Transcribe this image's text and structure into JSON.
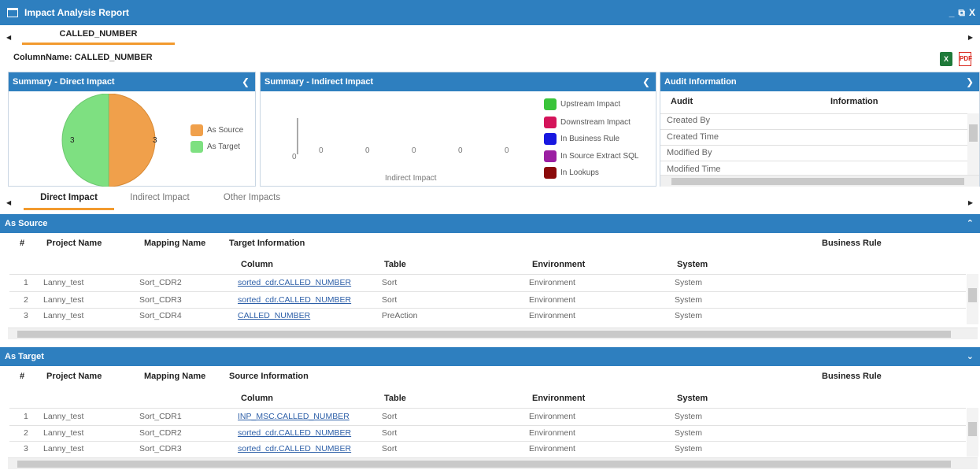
{
  "window": {
    "title": "Impact Analysis Report",
    "minimize": "_",
    "restore": "⧉",
    "close": "X"
  },
  "top_tab": {
    "label": "CALLED_NUMBER"
  },
  "column_name_label": "ColumnName: CALLED_NUMBER",
  "export": {
    "excel_icon": "excel-export-icon",
    "pdf_icon": "pdf-export-icon"
  },
  "direct_panel": {
    "title": "Summary - Direct Impact",
    "legend": [
      {
        "label": "As Source",
        "color": "#f0a04b"
      },
      {
        "label": "As Target",
        "color": "#7ee081"
      }
    ],
    "pie_labels": {
      "target": "3",
      "source": "3"
    }
  },
  "indirect_panel": {
    "title": "Summary - Indirect Impact",
    "axis_zero": "0",
    "bar_zero_labels": [
      "0",
      "0",
      "0",
      "0",
      "0"
    ],
    "x_label": "Indirect Impact",
    "legend": [
      {
        "label": "Upstream Impact",
        "color": "#3ac43a"
      },
      {
        "label": "Downstream Impact",
        "color": "#d4145a"
      },
      {
        "label": "In Business Rule",
        "color": "#1818e0"
      },
      {
        "label": "In Source Extract SQL",
        "color": "#9b1fa2"
      },
      {
        "label": "In Lookups",
        "color": "#8b0a0a"
      }
    ]
  },
  "audit_panel": {
    "title": "Audit Information",
    "headers": {
      "audit": "Audit",
      "information": "Information"
    },
    "rows": [
      "Created By",
      "Created Time",
      "Modified By",
      "Modified Time"
    ]
  },
  "tabs": [
    "Direct Impact",
    "Indirect Impact",
    "Other Impacts"
  ],
  "as_source": {
    "title": "As Source",
    "headers": {
      "num": "#",
      "project": "Project Name",
      "mapping": "Mapping Name",
      "target_info": "Target Information",
      "business_rule": "Business Rule",
      "column": "Column",
      "table": "Table",
      "environment": "Environment",
      "system": "System"
    },
    "rows": [
      {
        "num": "1",
        "project": "Lanny_test",
        "mapping": "Sort_CDR2",
        "column": "sorted_cdr.CALLED_NUMBER",
        "table": "Sort",
        "environment": "Environment",
        "system": "System"
      },
      {
        "num": "2",
        "project": "Lanny_test",
        "mapping": "Sort_CDR3",
        "column": "sorted_cdr.CALLED_NUMBER",
        "table": "Sort",
        "environment": "Environment",
        "system": "System"
      },
      {
        "num": "3",
        "project": "Lanny_test",
        "mapping": "Sort_CDR4",
        "column": "CALLED_NUMBER",
        "table": "PreAction",
        "environment": "Environment",
        "system": "System"
      }
    ]
  },
  "as_target": {
    "title": "As Target",
    "headers": {
      "num": "#",
      "project": "Project Name",
      "mapping": "Mapping Name",
      "source_info": "Source Information",
      "business_rule": "Business Rule",
      "column": "Column",
      "table": "Table",
      "environment": "Environment",
      "system": "System"
    },
    "rows": [
      {
        "num": "1",
        "project": "Lanny_test",
        "mapping": "Sort_CDR1",
        "column": "INP_MSC.CALLED_NUMBER",
        "table": "Sort",
        "environment": "Environment",
        "system": "System"
      },
      {
        "num": "2",
        "project": "Lanny_test",
        "mapping": "Sort_CDR2",
        "column": "sorted_cdr.CALLED_NUMBER",
        "table": "Sort",
        "environment": "Environment",
        "system": "System"
      },
      {
        "num": "3",
        "project": "Lanny_test",
        "mapping": "Sort_CDR3",
        "column": "sorted_cdr.CALLED_NUMBER",
        "table": "Sort",
        "environment": "Environment",
        "system": "System"
      }
    ]
  }
}
